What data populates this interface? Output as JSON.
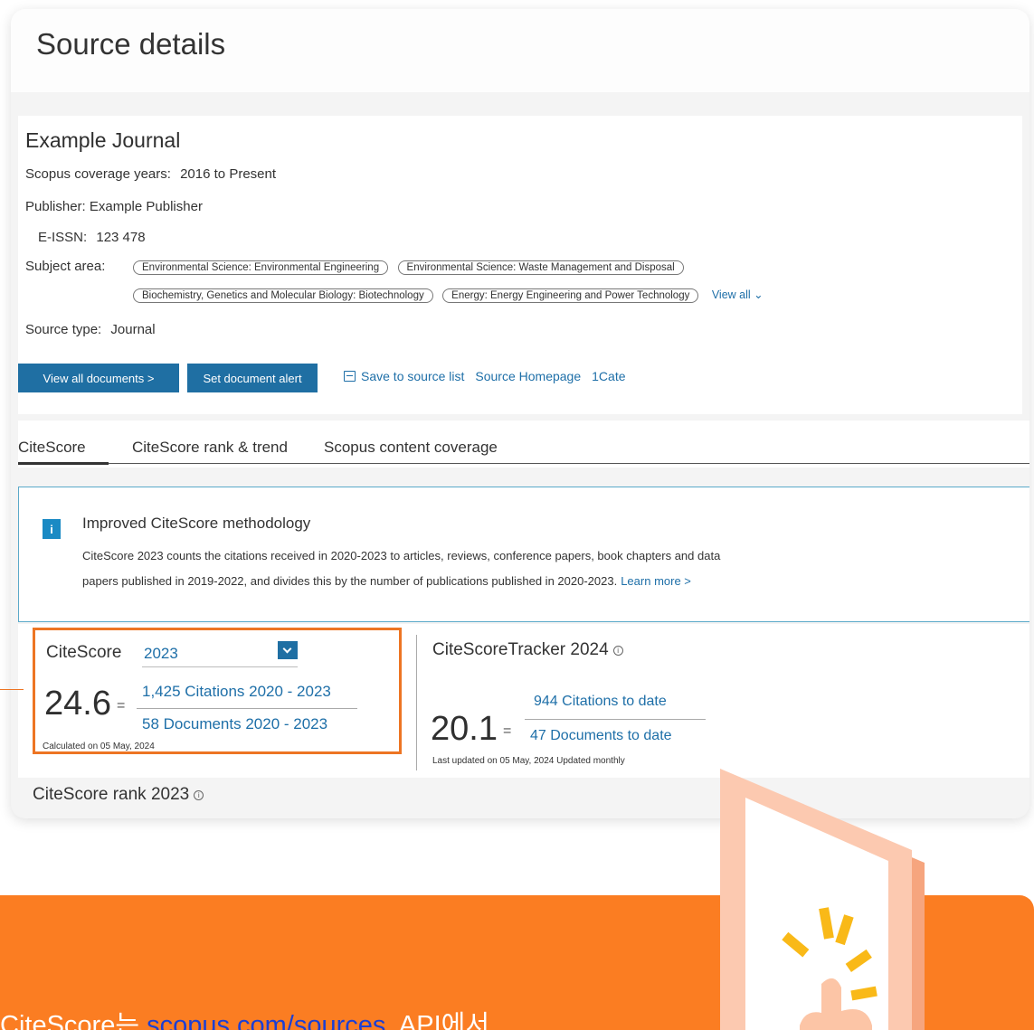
{
  "header": {
    "title": "Source details"
  },
  "journal": {
    "title": "Example Journal",
    "coverage_label": "Scopus coverage years:",
    "coverage_start": "2016",
    "coverage_end": "to Present",
    "publisher_label": "Publisher:",
    "publisher": "Example Publisher",
    "issn_label": "E-ISSN:",
    "issn": "123 478",
    "subject_label": "Subject area:",
    "subjects": [
      "Environmental Science: Environmental Engineering",
      "Environmental Science: Waste Management and Disposal",
      "Biochemistry, Genetics and Molecular Biology: Biotechnology",
      "Energy: Energy Engineering and Power Technology"
    ],
    "view_all": "View all",
    "source_type_label": "Source type:",
    "source_type": "Journal"
  },
  "actions": {
    "view_all_documents": "View all documents >",
    "set_alert": "Set document alert",
    "save_to_list": "Save to source list",
    "source_homepage": "Source Homepage",
    "icate": "1Cate"
  },
  "tabs": [
    "CiteScore",
    "CiteScore rank & trend",
    "Scopus content coverage"
  ],
  "methodology": {
    "icon": "i",
    "title": "Improved CiteScore methodology",
    "line1": "CiteScore 2023 counts the citations received in 2020-2023 to articles, reviews, conference papers, book chapters and data",
    "line2": "papers published in 2019-2022, and divides this by the number of publications published in 2020-2023.",
    "learn_more": "Learn more >"
  },
  "citescore": {
    "label": "CiteScore",
    "year": "2023",
    "value": "24.6",
    "eq": "=",
    "citations": "1,425 Citations 2020 - 2023",
    "documents": "58 Documents 2020 - 2023",
    "calculated": "Calculated on 05 May, 2024"
  },
  "tracker": {
    "title": "CiteScoreTracker 2024",
    "value": "20.1",
    "eq": "=",
    "citations": "944 Citations to date",
    "documents": "47 Documents to date",
    "updated": "Last updated on 05 May, 2024 Updated monthly"
  },
  "rank": {
    "title": "CiteScore rank 2023"
  },
  "banner": {
    "text_pre": "CiteScore는 ",
    "link": "scopus.com/sources",
    "text_post": ", API에서"
  },
  "colors": {
    "accent_blue": "#1f6fa3",
    "highlight_orange": "#ed7523",
    "banner_orange": "#fb7d22"
  }
}
